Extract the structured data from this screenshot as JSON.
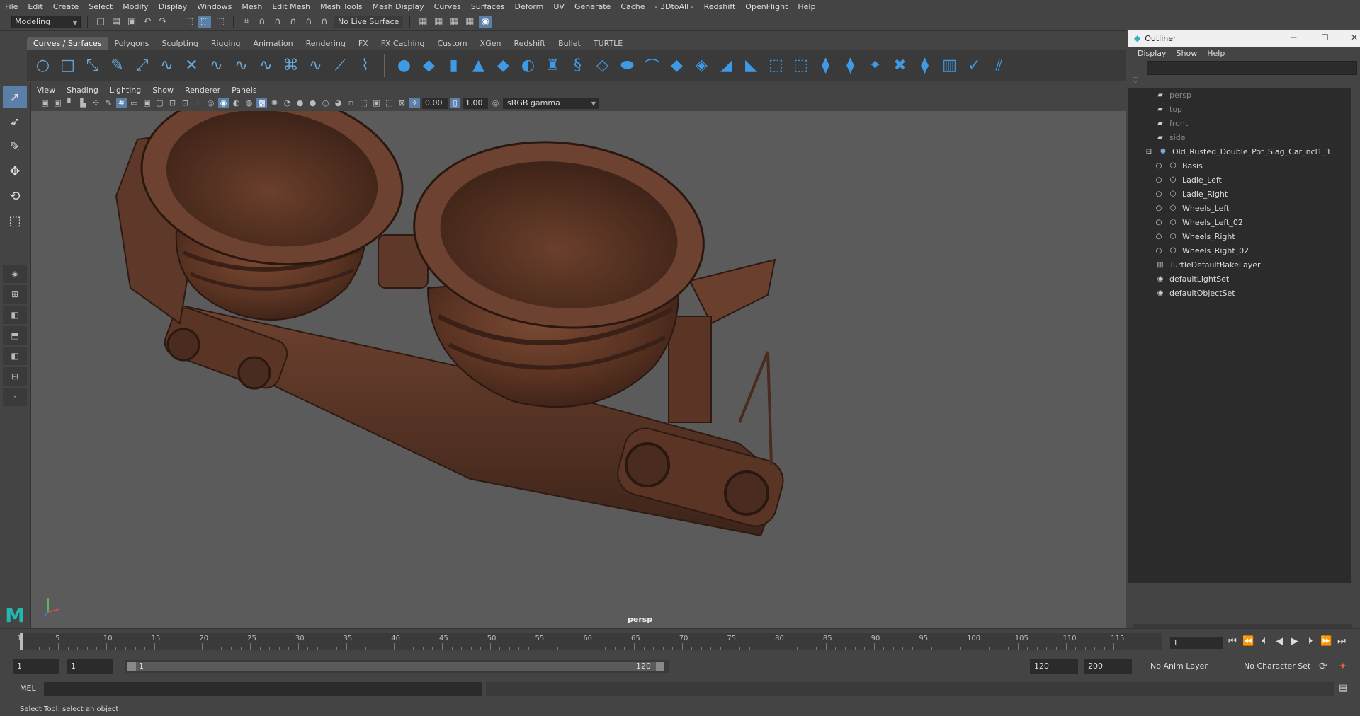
{
  "menubar": [
    "File",
    "Edit",
    "Create",
    "Select",
    "Modify",
    "Display",
    "Windows",
    "Mesh",
    "Edit Mesh",
    "Mesh Tools",
    "Mesh Display",
    "Curves",
    "Surfaces",
    "Deform",
    "UV",
    "Generate",
    "Cache",
    "- 3DtoAll -",
    "Redshift",
    "OpenFlight",
    "Help"
  ],
  "status": {
    "mode": "Modeling",
    "live_surface": "No Live Surface"
  },
  "shelf_tabs": [
    "Curves / Surfaces",
    "Polygons",
    "Sculpting",
    "Rigging",
    "Animation",
    "Rendering",
    "FX",
    "FX Caching",
    "Custom",
    "XGen",
    "Redshift",
    "Bullet",
    "TURTLE"
  ],
  "panel_menu": [
    "View",
    "Shading",
    "Lighting",
    "Show",
    "Renderer",
    "Panels"
  ],
  "panel_tools": {
    "exposure": "0.00",
    "gamma": "1.00",
    "color_space": "sRGB gamma"
  },
  "viewport": {
    "camera": "persp"
  },
  "outliner": {
    "title": "Outliner",
    "menu": [
      "Display",
      "Show",
      "Help"
    ],
    "items": [
      {
        "label": "persp",
        "icon": "camera-icon",
        "depth": 0,
        "dim": true
      },
      {
        "label": "top",
        "icon": "camera-icon",
        "depth": 0,
        "dim": true
      },
      {
        "label": "front",
        "icon": "camera-icon",
        "depth": 0,
        "dim": true
      },
      {
        "label": "side",
        "icon": "camera-icon",
        "depth": 0,
        "dim": true
      },
      {
        "label": "Old_Rusted_Double_Pot_Slag_Car_ncl1_1",
        "icon": "group-icon",
        "depth": 0,
        "dim": false,
        "expanded": true
      },
      {
        "label": "Basis",
        "icon": "mesh-icon",
        "depth": 1,
        "dim": false
      },
      {
        "label": "Ladle_Left",
        "icon": "mesh-icon",
        "depth": 1,
        "dim": false
      },
      {
        "label": "Ladle_Right",
        "icon": "mesh-icon",
        "depth": 1,
        "dim": false
      },
      {
        "label": "Wheels_Left",
        "icon": "mesh-icon",
        "depth": 1,
        "dim": false
      },
      {
        "label": "Wheels_Left_02",
        "icon": "mesh-icon",
        "depth": 1,
        "dim": false
      },
      {
        "label": "Wheels_Right",
        "icon": "mesh-icon",
        "depth": 1,
        "dim": false
      },
      {
        "label": "Wheels_Right_02",
        "icon": "mesh-icon",
        "depth": 1,
        "dim": false
      },
      {
        "label": "TurtleDefaultBakeLayer",
        "icon": "layer-icon",
        "depth": 0,
        "dim": false
      },
      {
        "label": "defaultLightSet",
        "icon": "set-icon",
        "depth": 0,
        "dim": false
      },
      {
        "label": "defaultObjectSet",
        "icon": "set-icon",
        "depth": 0,
        "dim": false
      }
    ]
  },
  "timeline": {
    "ticks": [
      "1",
      "5",
      "10",
      "15",
      "20",
      "25",
      "30",
      "35",
      "40",
      "45",
      "50",
      "55",
      "60",
      "65",
      "70",
      "75",
      "80",
      "85",
      "90",
      "95",
      "100",
      "105",
      "110",
      "115"
    ],
    "start": 1,
    "end": 120,
    "current_frame": "1"
  },
  "range": {
    "start": "1",
    "playback_start": "1",
    "slider_start": "1",
    "slider_end": "120",
    "playback_end": "120",
    "end": "200",
    "anim_layer": "No Anim Layer",
    "character_set": "No Character Set"
  },
  "command": {
    "lang": "MEL"
  },
  "help_line": "Select Tool: select an object"
}
